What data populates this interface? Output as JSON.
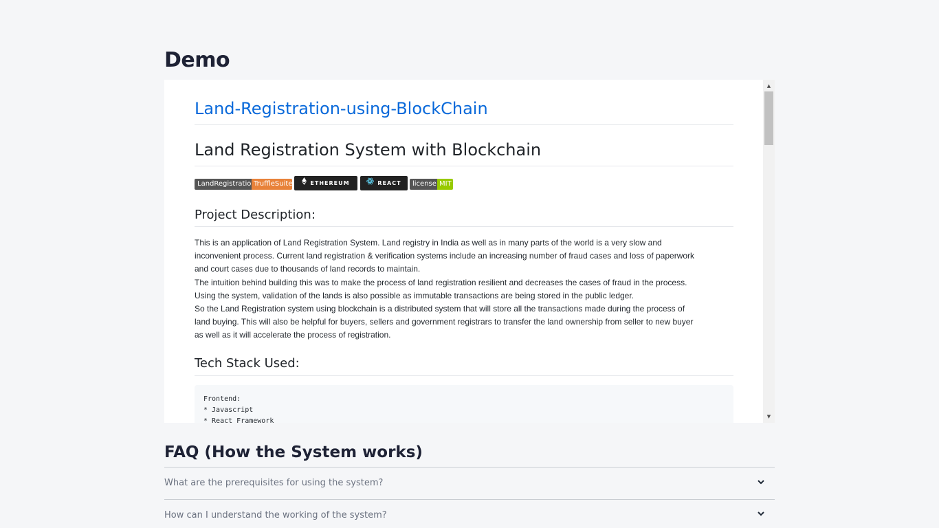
{
  "demo": {
    "title": "Demo",
    "readme": {
      "repo_title": "Land-Registration-using-BlockChain",
      "h1": "Land Registration System with Blockchain",
      "badges": [
        {
          "left": "LandRegistration",
          "right": "TruffleSuite"
        },
        {
          "label": "ETHEREUM"
        },
        {
          "label": "REACT"
        },
        {
          "left": "license",
          "right": "MIT"
        }
      ],
      "description_heading": "Project Description:",
      "description_lines": [
        "This is an application of Land Registration System. Land registry in India as well as in many parts of the world is a very slow and",
        "inconvenient process. Current land registration & verification systems include an increasing number of fraud cases and loss of paperwork",
        "and court cases due to thousands of land records to maintain.",
        "The intuition behind building this was to make the process of land registration resilient and decreases the cases of fraud in the process.",
        "Using the system, validation of the lands is also possible as immutable transactions are being stored in the public ledger.",
        "So the Land Registration system using blockchain is a distributed system that will store all the transactions made during the process of",
        "land buying. This will also be helpful for buyers, sellers and government registrars to transfer the land ownership from seller to new buyer",
        "as well as it will accelerate the process of registration."
      ],
      "tech_heading": "Tech Stack Used:",
      "code_lines": [
        "Frontend:",
        "* Javascript",
        "* React Framework"
      ]
    }
  },
  "faq": {
    "title": "FAQ (How the System works)",
    "items": [
      {
        "question": "What are the prerequisites for using the system?"
      },
      {
        "question": "How can I understand the working of the system?"
      }
    ]
  },
  "colors": {
    "link": "#0969da",
    "page_bg": "#f5f6f8",
    "badge_truffle": "#e8823a",
    "badge_mit": "#97ca00",
    "badge_dark": "#222222"
  },
  "icons": [
    "chevron-down-icon",
    "ethereum-icon",
    "react-icon",
    "scroll-up-arrow-icon",
    "scroll-down-arrow-icon"
  ]
}
